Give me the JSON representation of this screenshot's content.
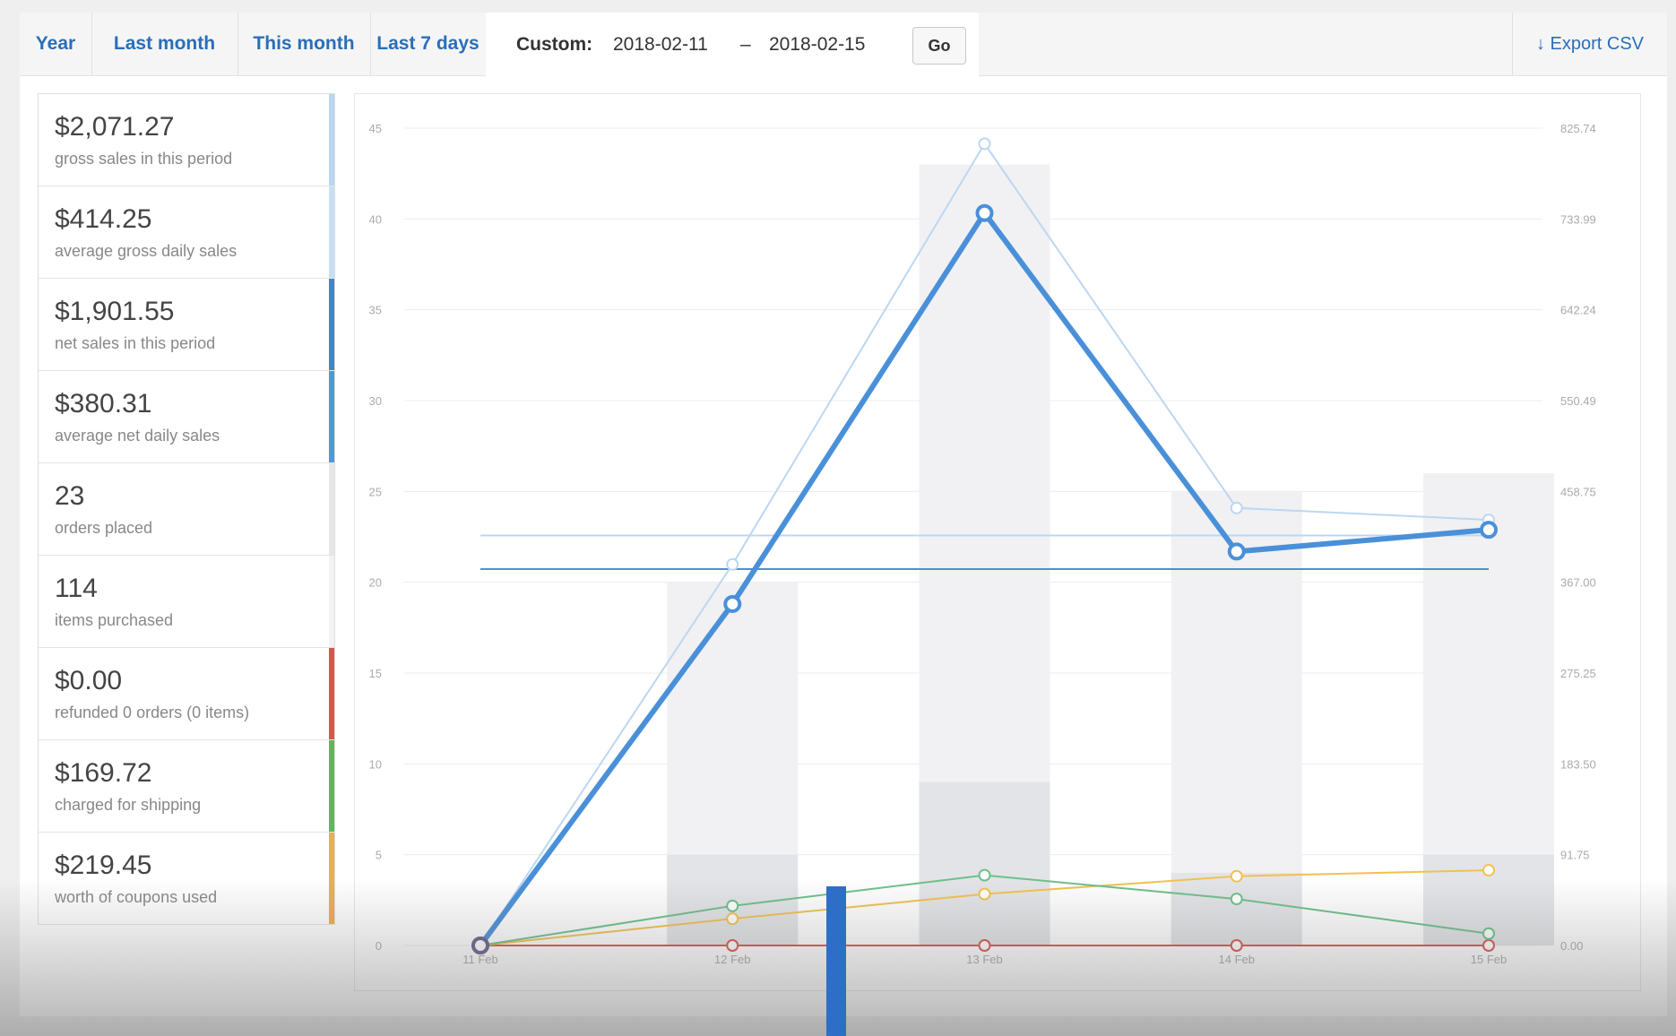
{
  "tabs": [
    {
      "label": "Year"
    },
    {
      "label": "Last month"
    },
    {
      "label": "This month"
    },
    {
      "label": "Last 7 days"
    }
  ],
  "custom": {
    "label": "Custom:",
    "from": "2018-02-11",
    "separator": "–",
    "to": "2018-02-15",
    "go_label": "Go"
  },
  "export": {
    "label": "Export CSV",
    "icon": "arrow-down-icon"
  },
  "stats": [
    {
      "value": "$2,071.27",
      "desc": "gross sales in this period",
      "color": "#b9d6f0"
    },
    {
      "value": "$414.25",
      "desc": "average gross daily sales",
      "color": "#c8dff3"
    },
    {
      "value": "$1,901.55",
      "desc": "net sales in this period",
      "color": "#3a87cf"
    },
    {
      "value": "$380.31",
      "desc": "average net daily sales",
      "color": "#5297d6"
    },
    {
      "value": "23",
      "desc": "orders placed",
      "color": "#e6e6e6"
    },
    {
      "value": "114",
      "desc": "items purchased",
      "color": "#f2f2f2"
    },
    {
      "value": "$0.00",
      "desc": "refunded 0 orders (0 items)",
      "color": "#d9534f"
    },
    {
      "value": "$169.72",
      "desc": "charged for shipping",
      "color": "#5cb85c"
    },
    {
      "value": "$219.45",
      "desc": "worth of coupons used",
      "color": "#f0ad4e"
    }
  ],
  "chart_data": {
    "type": "bar",
    "categories": [
      "11 Feb",
      "12 Feb",
      "13 Feb",
      "14 Feb",
      "15 Feb"
    ],
    "left_axis": {
      "ticks": [
        0,
        5,
        10,
        15,
        20,
        25,
        30,
        35,
        40,
        45
      ],
      "range": [
        0,
        45
      ]
    },
    "right_axis": {
      "ticks": [
        "0.00",
        "91.75",
        "183.50",
        "275.25",
        "367.00",
        "458.75",
        "550.49",
        "642.24",
        "733.99",
        "825.74"
      ],
      "range": [
        0,
        825.74
      ]
    },
    "grid": true,
    "bars": [
      {
        "name": "items purchased",
        "values": [
          0,
          20,
          43,
          25,
          26
        ],
        "color": "#f1f1f3"
      },
      {
        "name": "orders placed",
        "values": [
          0,
          5,
          9,
          4,
          5
        ],
        "color": "#e3e4e7"
      }
    ],
    "lines": [
      {
        "name": "gross sales",
        "axis": "right",
        "values": [
          0,
          385,
          810,
          442,
          430
        ],
        "color": "#bcd7f1",
        "width": 2
      },
      {
        "name": "net sales",
        "axis": "right",
        "values": [
          0,
          345,
          740,
          398,
          420
        ],
        "color": "#4a90d9",
        "width": 6
      },
      {
        "name": "shipping",
        "axis": "right",
        "values": [
          0,
          40,
          71,
          47,
          12
        ],
        "color": "#6cc08a",
        "width": 2
      },
      {
        "name": "coupons",
        "axis": "right",
        "values": [
          0,
          27,
          52,
          70,
          76
        ],
        "color": "#f2c14e",
        "width": 2
      },
      {
        "name": "refunds",
        "axis": "right",
        "values": [
          0,
          0,
          0,
          0,
          0
        ],
        "color": "#d9534f",
        "width": 2
      }
    ],
    "average_lines": [
      {
        "name": "average gross daily sales",
        "axis": "right",
        "value": 414.25,
        "color": "#bcd7f1"
      },
      {
        "name": "average net daily sales",
        "axis": "right",
        "value": 380.31,
        "color": "#4a90d9"
      }
    ]
  }
}
